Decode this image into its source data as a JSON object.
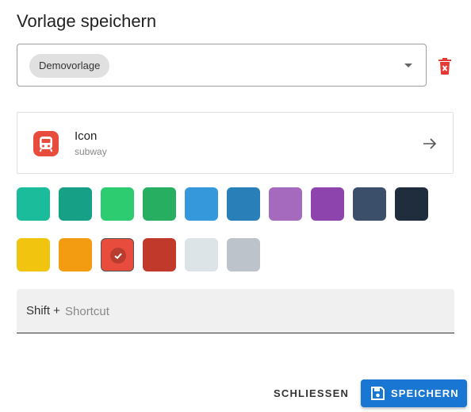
{
  "dialog": {
    "title": "Vorlage speichern"
  },
  "template_select": {
    "selected_chip": "Demovorlage",
    "icon": "chevron-down-icon"
  },
  "delete_button": {
    "icon": "trash-x-icon",
    "color": "#e53935"
  },
  "icon_card": {
    "title": "Icon",
    "subtitle": "subway",
    "badge_icon": "subway-icon",
    "badge_color": "#e74c3c",
    "arrow_icon": "arrow-right-icon"
  },
  "colors": {
    "selected": "#e74c3c",
    "row1": [
      "#1abc9c",
      "#16a085",
      "#2ecc71",
      "#27ae60",
      "#3498db",
      "#2980b9",
      "#a569bd",
      "#8e44ad",
      "#3b4f6b",
      "#1f2d3d"
    ],
    "row2": [
      "#f1c40f",
      "#f39c12",
      "#e74c3c",
      "#c0392b",
      "#dde4e8",
      "#bdc3cb"
    ]
  },
  "shortcut": {
    "prefix": "Shift +",
    "placeholder": "Shortcut",
    "value": ""
  },
  "actions": {
    "close_label": "SCHLIESSEN",
    "save_label": "SPEICHERN",
    "save_icon": "floppy-disk-icon",
    "primary_color": "#1976d2"
  }
}
